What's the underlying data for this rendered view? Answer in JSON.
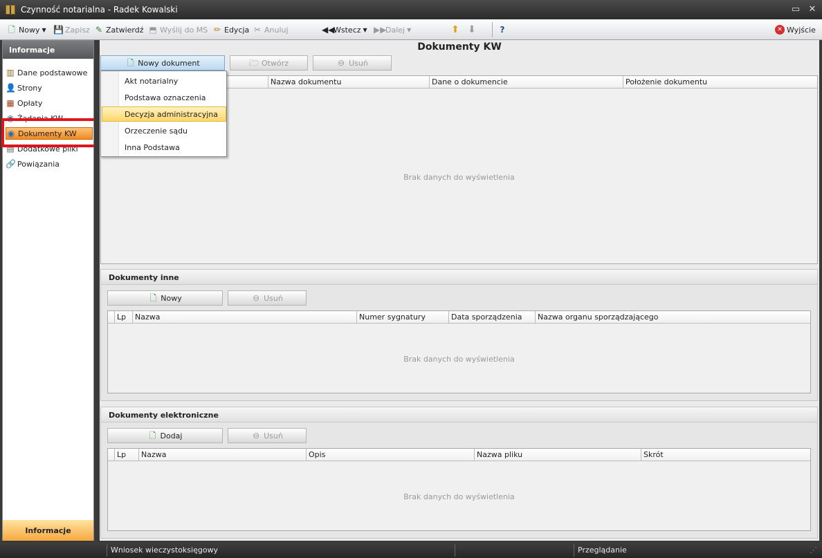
{
  "window": {
    "title": "Czynność notarialna - Radek Kowalski"
  },
  "toolbar": {
    "new": "Nowy",
    "save": "Zapisz",
    "approve": "Zatwierdź",
    "send_ms": "Wyślij do MS",
    "edit": "Edycja",
    "cancel": "Anuluj",
    "back": "Wstecz",
    "next": "Dalej",
    "exit": "Wyjście"
  },
  "nav": {
    "header": "Informacje",
    "items": [
      "Dane podstawowe",
      "Strony",
      "Opłaty",
      "Żądania KW",
      "Dokumenty KW",
      "Dodatkowe pliki",
      "Powiązania"
    ],
    "footer": "Informacje"
  },
  "page": {
    "title": "Dokumenty KW",
    "new_doc": "Nowy dokument",
    "open": "Otwórz",
    "delete": "Usuń",
    "columns": [
      "Nazwa dokumentu",
      "Dane o dokumencie",
      "Położenie dokumentu"
    ],
    "empty": "Brak danych do wyświetlenia"
  },
  "menu": {
    "items": [
      "Akt notarialny",
      "Podstawa oznaczenia",
      "Decyzja administracyjna",
      "Orzeczenie sądu",
      "Inna Podstawa"
    ],
    "highlighted": "Decyzja administracyjna"
  },
  "other_docs": {
    "title": "Dokumenty inne",
    "new": "Nowy",
    "delete": "Usuń",
    "columns": [
      "Lp",
      "Nazwa",
      "Numer sygnatury",
      "Data sporządzenia",
      "Nazwa organu sporządzającego"
    ],
    "empty": "Brak danych do wyświetlenia"
  },
  "edocs": {
    "title": "Dokumenty elektroniczne",
    "add": "Dodaj",
    "delete": "Usuń",
    "columns": [
      "Lp",
      "Nazwa",
      "Opis",
      "Nazwa pliku",
      "Skrót"
    ],
    "empty": "Brak danych do wyświetlenia"
  },
  "status": {
    "left": "Wniosek wieczystoksięgowy",
    "right": "Przeglądanie"
  },
  "colors": {
    "accent": "#f08a20",
    "highlight_box": "#e0141c"
  }
}
